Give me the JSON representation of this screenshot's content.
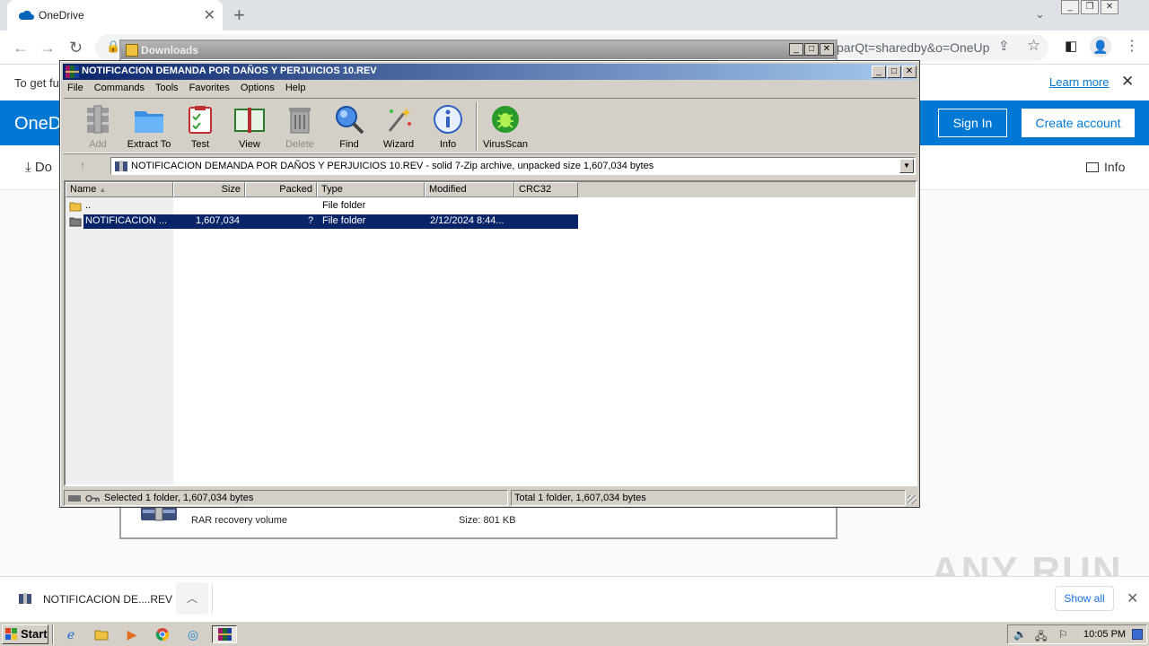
{
  "browser": {
    "tab_title": "OneDrive",
    "tab_close": "✕",
    "new_tab": "+",
    "url_visible": "parQt=sharedby&o=OneUp"
  },
  "onedrive": {
    "notice_text": "To get fu",
    "learn_more": "Learn more",
    "brand": "OneD",
    "sign_in": "Sign In",
    "create_account": "Create account",
    "download_label": "Do",
    "info_label": "Info"
  },
  "explorer": {
    "title": "Downloads",
    "file_type": "RAR recovery volume",
    "file_size": "Size: 801 KB"
  },
  "winrar": {
    "title": "NOTIFICACION DEMANDA POR DAÑOS Y PERJUICIOS 10.REV",
    "menu": [
      "File",
      "Commands",
      "Tools",
      "Favorites",
      "Options",
      "Help"
    ],
    "tools": {
      "add": "Add",
      "extract": "Extract To",
      "test": "Test",
      "view": "View",
      "delete": "Delete",
      "find": "Find",
      "wizard": "Wizard",
      "info": "Info",
      "virusscan": "VirusScan"
    },
    "path": "NOTIFICACION DEMANDA POR DAÑOS Y PERJUICIOS 10.REV - solid 7-Zip archive, unpacked size 1,607,034 bytes",
    "columns": {
      "name": "Name",
      "size": "Size",
      "packed": "Packed",
      "type": "Type",
      "modified": "Modified",
      "crc": "CRC32"
    },
    "rows": [
      {
        "name": "..",
        "size": "",
        "packed": "",
        "type": "File folder",
        "modified": ""
      },
      {
        "name": "NOTIFICACION ...",
        "size": "1,607,034",
        "packed": "?",
        "type": "File folder",
        "modified": "2/12/2024 8:44..."
      }
    ],
    "status_left": "Selected 1 folder, 1,607,034 bytes",
    "status_right": "Total 1 folder, 1,607,034 bytes"
  },
  "shelf": {
    "download_name": "NOTIFICACION DE....REV",
    "show_all": "Show all"
  },
  "watermark": "ANY RUN",
  "taskbar": {
    "start": "Start",
    "clock": "10:05 PM"
  }
}
